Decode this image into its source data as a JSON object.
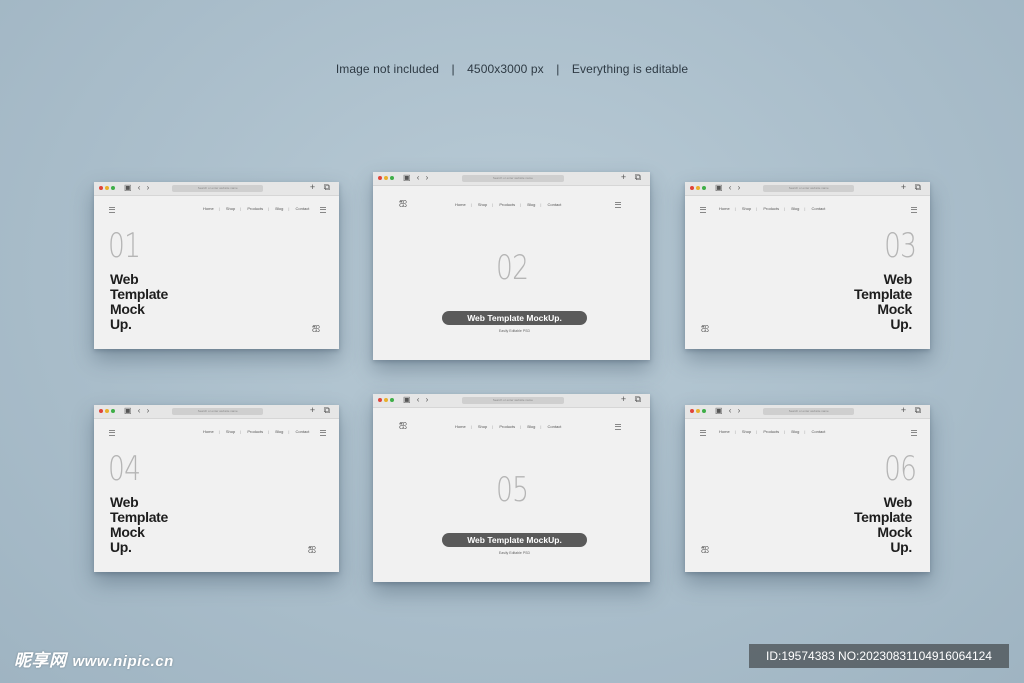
{
  "header": {
    "items": [
      "Image not included",
      "4500x3000 px",
      "Everything is editable"
    ],
    "separator": "|"
  },
  "toolbar": {
    "left_icons": "▣ ‹ ›",
    "url_placeholder": "Search or enter website name",
    "right_icons": "+ ⧉"
  },
  "nav_items": [
    "Home",
    "Shop",
    "Products",
    "Blog",
    "Contact"
  ],
  "nav_separator": "|",
  "logo_glyph": "ஐ",
  "hero_lines": [
    "Web",
    "Template",
    "Mock",
    "Up."
  ],
  "pill_label": "Web Template MockUp.",
  "pill_subtext": "Easily Editable PSD",
  "windows": [
    {
      "number": "01"
    },
    {
      "number": "02"
    },
    {
      "number": "03"
    },
    {
      "number": "04"
    },
    {
      "number": "05"
    },
    {
      "number": "06"
    }
  ],
  "watermark": {
    "brand": "昵享网",
    "site": "www.nipic.cn",
    "id_text": "ID:19574383 NO:20230831104916064124"
  },
  "colors": {
    "background": "#aabfcc",
    "window": "#f1f1f1",
    "pill": "#5a5a5a",
    "dot_red": "#e0443a",
    "dot_yellow": "#e8b02c",
    "dot_green": "#3fae48"
  }
}
